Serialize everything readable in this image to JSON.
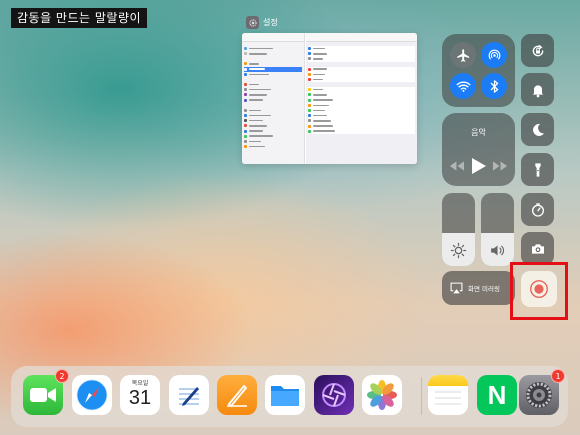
{
  "caption": "감동을 만드는 말랄량이",
  "app_switcher": {
    "app_name": "설정"
  },
  "control_center": {
    "music_title": "음악",
    "screen_mirroring_label": "화면 미러링"
  },
  "dock": {
    "facetime_badge": "2",
    "calendar_weekday": "목요일",
    "calendar_date": "31",
    "settings_badge": "1"
  },
  "colors": {
    "active_blue": "#1b7cf5",
    "highlight_red": "#e30e16"
  }
}
